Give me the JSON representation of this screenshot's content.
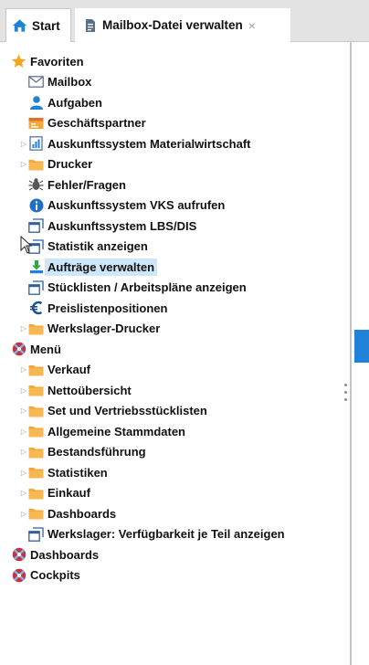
{
  "tabs": [
    {
      "label": "Start",
      "icon": "home-icon"
    },
    {
      "label": "Mailbox-Datei verwalten",
      "icon": "document-icon",
      "close_glyph": "×"
    }
  ],
  "tree": {
    "favoriten": {
      "label": "Favoriten",
      "items": [
        {
          "label": "Mailbox",
          "icon": "mail-icon"
        },
        {
          "label": "Aufgaben",
          "icon": "user-icon"
        },
        {
          "label": "Geschäftspartner",
          "icon": "contact-card-icon"
        },
        {
          "label": "Auskunftssystem Materialwirtschaft",
          "icon": "report-icon",
          "expandable": true
        },
        {
          "label": "Drucker",
          "icon": "folder-icon",
          "expandable": true
        },
        {
          "label": "Fehler/Fragen",
          "icon": "bug-icon"
        },
        {
          "label": "Auskunftssystem VKS aufrufen",
          "icon": "info-icon"
        },
        {
          "label": "Auskunftssystem LBS/DIS",
          "icon": "window-icon"
        },
        {
          "label": "Statistik anzeigen",
          "icon": "window-icon"
        },
        {
          "label": "Aufträge verwalten",
          "icon": "download-icon",
          "selected": true
        },
        {
          "label": "Stücklisten / Arbeitspläne anzeigen",
          "icon": "window-icon"
        },
        {
          "label": "Preislistenpositionen",
          "icon": "euro-icon"
        },
        {
          "label": "Werkslager-Drucker",
          "icon": "folder-icon",
          "expandable": true
        }
      ]
    },
    "menu": {
      "label": "Menü",
      "items": [
        {
          "label": "Verkauf",
          "icon": "folder-icon",
          "expandable": true
        },
        {
          "label": "Nettoübersicht",
          "icon": "folder-icon",
          "expandable": true
        },
        {
          "label": "Set und Vertriebsstücklisten",
          "icon": "folder-icon",
          "expandable": true
        },
        {
          "label": "Allgemeine Stammdaten",
          "icon": "folder-icon",
          "expandable": true
        },
        {
          "label": "Bestandsführung",
          "icon": "folder-icon",
          "expandable": true
        },
        {
          "label": "Statistiken",
          "icon": "folder-icon",
          "expandable": true
        },
        {
          "label": "Einkauf",
          "icon": "folder-icon",
          "expandable": true
        },
        {
          "label": "Dashboards",
          "icon": "folder-icon",
          "expandable": true
        },
        {
          "label": "Werkslager: Verfügbarkeit je Teil anzeigen",
          "icon": "window-icon"
        }
      ]
    },
    "dashboards": {
      "label": "Dashboards"
    },
    "cockpits": {
      "label": "Cockpits"
    }
  },
  "colors": {
    "selected_bg": "#cde6fa",
    "folder": "#f5a93a",
    "star": "#f4a622",
    "accent_blue": "#1f82d6",
    "menu_red": "#c8323c"
  }
}
